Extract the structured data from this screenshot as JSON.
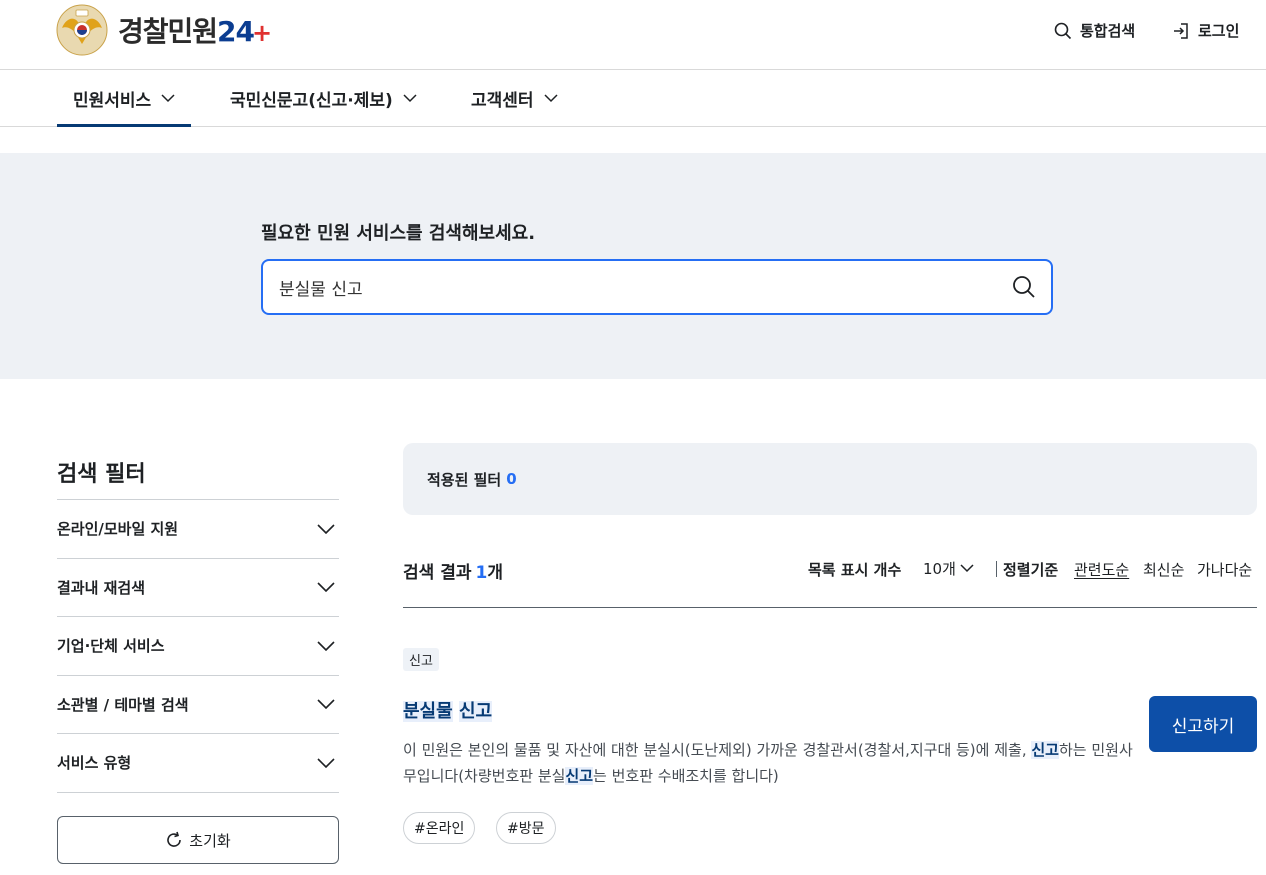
{
  "header": {
    "logo_text": "경찰민원",
    "logo_num": "24",
    "logo_plus": "+",
    "search_label": "통합검색",
    "login_label": "로그인"
  },
  "gnb": {
    "items": [
      {
        "label": "민원서비스"
      },
      {
        "label": "국민신문고(신고·제보)"
      },
      {
        "label": "고객센터"
      }
    ]
  },
  "hero": {
    "title": "필요한 민원 서비스를 검색해보세요.",
    "search_value": "분실물 신고"
  },
  "filter": {
    "title": "검색 필터",
    "items": [
      {
        "label": "온라인/모바일 지원"
      },
      {
        "label": "결과내 재검색"
      },
      {
        "label": "기업·단체 서비스"
      },
      {
        "label": "소관별 / 테마별 검색"
      },
      {
        "label": "서비스 유형"
      }
    ],
    "reset_label": "초기화"
  },
  "applied": {
    "label": "적용된 필터",
    "count": "0"
  },
  "results": {
    "label": "검색 결과",
    "count": "1",
    "unit": "개",
    "list_label": "목록 표시 개수",
    "list_value": "10개",
    "sort_label": "정렬기준",
    "sort_options": [
      "관련도순",
      "최신순",
      "가나다순"
    ],
    "sort_active": "관련도순"
  },
  "item": {
    "badge": "신고",
    "title_part1": "분실물",
    "title_part2": "신고",
    "desc_part1": "이 민원은 본인의 물품 및 자산에 대한 분실시(도난제외) 가까운 경찰관서(경찰서,지구대 등)에 제출, ",
    "desc_kw1": "신고",
    "desc_part2": "하는 민원사무입니다(차량번호판 분실",
    "desc_kw2": "신고",
    "desc_part3": "는 번호판 수배조치를 합니다)",
    "apply_label": "신고하기",
    "tags": [
      "#온라인",
      "#방문"
    ]
  },
  "colors": {
    "primary": "#063a74",
    "accent_blue": "#256ef4",
    "button_blue": "#0d4fa8",
    "hero_bg": "#eef1f5"
  }
}
